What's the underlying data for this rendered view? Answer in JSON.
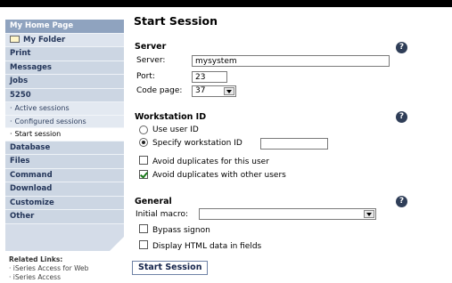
{
  "nav": {
    "home": "My Home Page",
    "folder": "My Folder",
    "print": "Print",
    "messages": "Messages",
    "jobs": "Jobs",
    "s5250": "5250",
    "sub": [
      "Active sessions",
      "Configured sessions",
      "Start session"
    ],
    "database": "Database",
    "files": "Files",
    "command": "Command",
    "download": "Download",
    "customize": "Customize",
    "other": "Other"
  },
  "related": {
    "title": "Related Links:",
    "links": [
      "iSeries Access for Web",
      "iSeries Access"
    ]
  },
  "page": {
    "title": "Start Session"
  },
  "server": {
    "title": "Server",
    "server_label": "Server:",
    "server_value": "mysystem",
    "port_label": "Port:",
    "port_value": "23",
    "codepage_label": "Code page:",
    "codepage_value": "37"
  },
  "workstation": {
    "title": "Workstation ID",
    "use_user": "Use user ID",
    "specify": "Specify workstation ID",
    "specify_value": "",
    "specify_selected": true,
    "avoid_user": "Avoid duplicates for this user",
    "avoid_user_checked": false,
    "avoid_others": "Avoid duplicates with other users",
    "avoid_others_checked": true
  },
  "general": {
    "title": "General",
    "macro_label": "Initial macro:",
    "macro_value": "",
    "bypass": "Bypass signon",
    "bypass_checked": false,
    "html_fields": "Display HTML data in fields",
    "html_fields_checked": false
  },
  "help_glyph": "?",
  "submit_label": "Start Session",
  "colors": {
    "nav_bg": "#ccd6e3",
    "nav_home": "#8fa3bf",
    "nav_text": "#24365a",
    "help_bg": "#2f3e58"
  }
}
